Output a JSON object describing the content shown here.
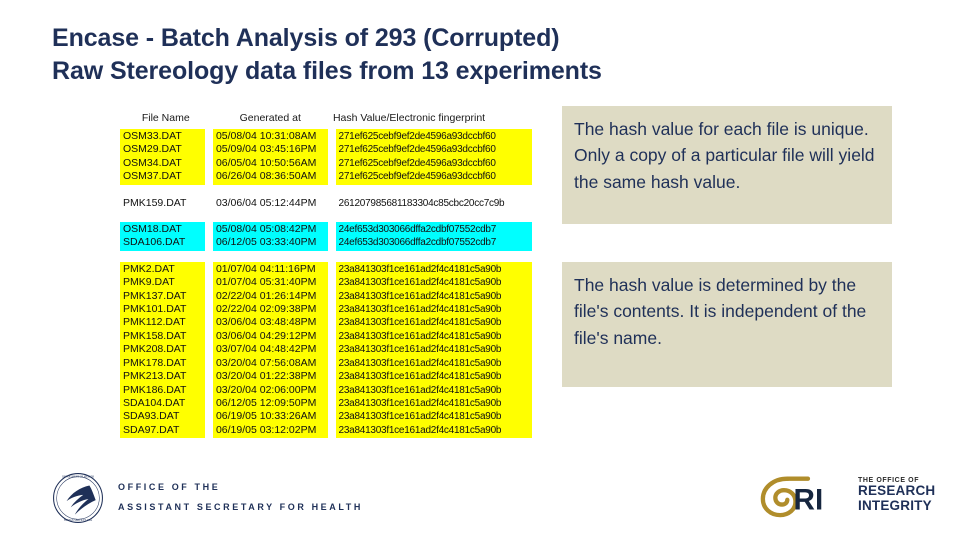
{
  "slide": {
    "title_line1": "Encase - Batch Analysis of 293 (Corrupted)",
    "title_line2_a": "Raw Stereology ",
    "title_line2_b": "data files from 13 experiments",
    "title_color": "#1f3058"
  },
  "table": {
    "headers": {
      "file_name": "File Name",
      "generated_at": "Generated at",
      "hash_value": "Hash Value/Electronic fingerprint"
    },
    "highlight_colors": {
      "yellow": "#ffff00",
      "cyan": "#00ffff",
      "none": "transparent"
    },
    "groups": [
      {
        "highlight": "yellow",
        "rows": [
          {
            "file": "OSM33.DAT",
            "generated": "05/08/04 10:31:08AM",
            "hash": "271ef625cebf9ef2de4596a93dccbf60"
          },
          {
            "file": "OSM29.DAT",
            "generated": "05/09/04 03:45:16PM",
            "hash": "271ef625cebf9ef2de4596a93dccbf60"
          },
          {
            "file": "OSM34.DAT",
            "generated": "06/05/04 10:50:56AM",
            "hash": "271ef625cebf9ef2de4596a93dccbf60"
          },
          {
            "file": "OSM37.DAT",
            "generated": "06/26/04 08:36:50AM",
            "hash": "271ef625cebf9ef2de4596a93dccbf60"
          }
        ]
      },
      {
        "highlight": "none",
        "rows": [
          {
            "file": "PMK159.DAT",
            "generated": "03/06/04 05:12:44PM",
            "hash": "261207985681183304c85cbc20cc7c9b"
          }
        ]
      },
      {
        "highlight": "cyan",
        "rows": [
          {
            "file": "OSM18.DAT",
            "generated": "05/08/04 05:08:42PM",
            "hash": "24ef653d303066dffa2cdbf07552cdb7"
          },
          {
            "file": "SDA106.DAT",
            "generated": "06/12/05 03:33:40PM",
            "hash": "24ef653d303066dffa2cdbf07552cdb7"
          }
        ]
      },
      {
        "highlight": "yellow",
        "rows": [
          {
            "file": "PMK2.DAT",
            "generated": "01/07/04 04:11:16PM",
            "hash": "23a841303f1ce161ad2f4c4181c5a90b"
          },
          {
            "file": "PMK9.DAT",
            "generated": "01/07/04 05:31:40PM",
            "hash": "23a841303f1ce161ad2f4c4181c5a90b"
          },
          {
            "file": "PMK137.DAT",
            "generated": "02/22/04 01:26:14PM",
            "hash": "23a841303f1ce161ad2f4c4181c5a90b"
          },
          {
            "file": "PMK101.DAT",
            "generated": "02/22/04 02:09:38PM",
            "hash": "23a841303f1ce161ad2f4c4181c5a90b"
          },
          {
            "file": "PMK112.DAT",
            "generated": "03/06/04 03:48:48PM",
            "hash": "23a841303f1ce161ad2f4c4181c5a90b"
          },
          {
            "file": "PMK158.DAT",
            "generated": "03/06/04 04:29:12PM",
            "hash": "23a841303f1ce161ad2f4c4181c5a90b"
          },
          {
            "file": "PMK208.DAT",
            "generated": "03/07/04 04:48:42PM",
            "hash": "23a841303f1ce161ad2f4c4181c5a90b"
          },
          {
            "file": "PMK178.DAT",
            "generated": "03/20/04 07:56:08AM",
            "hash": "23a841303f1ce161ad2f4c4181c5a90b"
          },
          {
            "file": "PMK213.DAT",
            "generated": "03/20/04 01:22:38PM",
            "hash": "23a841303f1ce161ad2f4c4181c5a90b"
          },
          {
            "file": "PMK186.DAT",
            "generated": "03/20/04 02:06:00PM",
            "hash": "23a841303f1ce161ad2f4c4181c5a90b"
          },
          {
            "file": "SDA104.DAT",
            "generated": "06/12/05 12:09:50PM",
            "hash": "23a841303f1ce161ad2f4c4181c5a90b"
          },
          {
            "file": "SDA93.DAT",
            "generated": "06/19/05 10:33:26AM",
            "hash": "23a841303f1ce161ad2f4c4181c5a90b"
          },
          {
            "file": "SDA97.DAT",
            "generated": "06/19/05 03:12:02PM",
            "hash": "23a841303f1ce161ad2f4c4181c5a90b"
          }
        ]
      }
    ]
  },
  "callouts": {
    "background": "#dedbc4",
    "text_color": "#1f3058",
    "unique": "The hash value for each file is unique. Only a copy of a particular file will yield the same hash value.",
    "contents": "The hash value is determined by the file's contents. It is independent of the file's name."
  },
  "footer": {
    "hhs_line1": "OFFICE OF THE",
    "hhs_line2": "ASSISTANT SECRETARY FOR HEALTH",
    "ori_initials": "ORI",
    "ori_small": "THE OFFICE OF",
    "ori_big1": "RESEARCH",
    "ori_big2": "INTEGRITY",
    "ori_registered": "®",
    "ori_gold": "#b08d2b",
    "navy": "#1f3058"
  }
}
